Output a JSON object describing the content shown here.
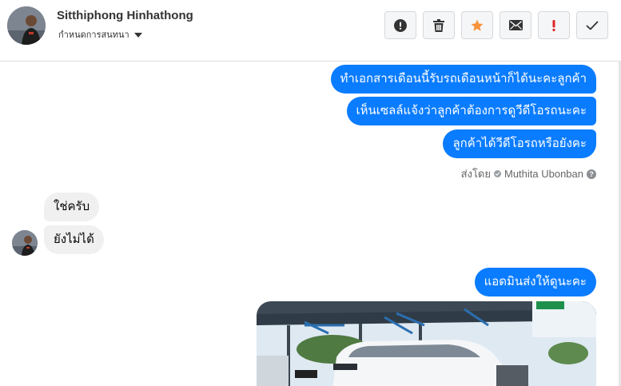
{
  "header": {
    "contact_name": "Sitthiphong Hinhathong",
    "subtitle": "กำหนดการสนทนา"
  },
  "toolbar": {
    "buttons": [
      {
        "name": "alert-circle",
        "color": "#333333"
      },
      {
        "name": "trash",
        "color": "#333333"
      },
      {
        "name": "star",
        "color": "#f7923a"
      },
      {
        "name": "envelope",
        "color": "#333333"
      },
      {
        "name": "exclamation",
        "color": "#e02424"
      },
      {
        "name": "checkmark",
        "color": "#333333"
      }
    ]
  },
  "messages": {
    "outgoing": [
      "ทำเอกสารเดือนนี้รับรถเดือนหน้าก็ได้นะคะลูกค้า",
      "เห็นเซลล์แจ้งว่าลูกค้าต้องการดูวีดีโอรถนะคะ",
      "ลูกค้าได้วีดีโอรถหรือยังคะ"
    ],
    "sent_by_prefix": "ส่งโดย",
    "sent_by_name": "Muthita Ubonban",
    "incoming": [
      "ใช่ครับ",
      "ยังไม่ได้"
    ],
    "outgoing_2": "แอดมินส่งให้ดูนะคะ"
  },
  "colors": {
    "outgoing_bubble": "#0a7cff",
    "incoming_bubble": "#f0f0f0"
  }
}
